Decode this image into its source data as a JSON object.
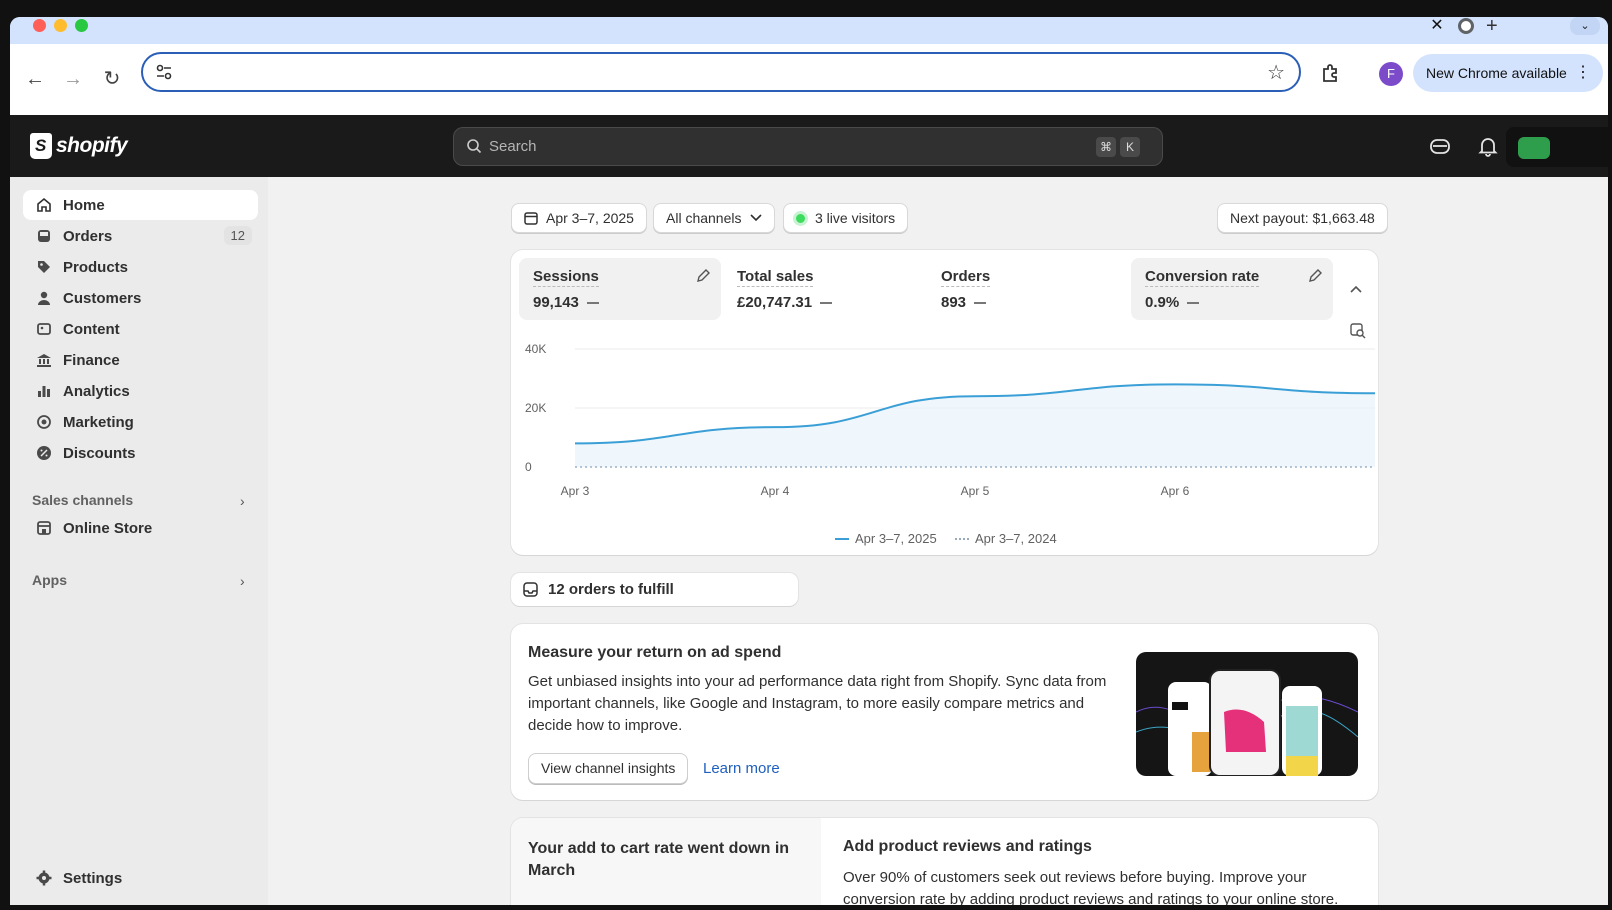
{
  "browser": {
    "new_chrome_label": "New Chrome available",
    "profile_initial": "F",
    "tab_close": "✕",
    "tab_new": "+",
    "tab_menu": "⌄"
  },
  "header": {
    "logo_text": "shopify",
    "search_placeholder": "Search",
    "shortcut_cmd": "⌘",
    "shortcut_key": "K"
  },
  "sidebar": {
    "items": [
      {
        "label": "Home",
        "icon": "home-icon"
      },
      {
        "label": "Orders",
        "icon": "inbox-icon",
        "badge": "12"
      },
      {
        "label": "Products",
        "icon": "tag-icon"
      },
      {
        "label": "Customers",
        "icon": "person-icon"
      },
      {
        "label": "Content",
        "icon": "image-icon"
      },
      {
        "label": "Finance",
        "icon": "bank-icon"
      },
      {
        "label": "Analytics",
        "icon": "bar-chart-icon"
      },
      {
        "label": "Marketing",
        "icon": "target-icon"
      },
      {
        "label": "Discounts",
        "icon": "discount-icon"
      }
    ],
    "sales_channels_heading": "Sales channels",
    "online_store_label": "Online Store",
    "apps_heading": "Apps",
    "settings_label": "Settings"
  },
  "filters": {
    "date_range": "Apr 3–7, 2025",
    "channels": "All channels",
    "live_visitors": "3 live visitors",
    "next_payout": "Next payout: $1,663.48"
  },
  "metrics": [
    {
      "label": "Sessions",
      "value": "99,143",
      "selected": true
    },
    {
      "label": "Total sales",
      "value": "£20,747.31",
      "selected": false
    },
    {
      "label": "Orders",
      "value": "893",
      "selected": false
    },
    {
      "label": "Conversion rate",
      "value": "0.9%",
      "selected": true
    }
  ],
  "chart_data": {
    "type": "line",
    "x": [
      "Apr 3",
      "Apr 4",
      "Apr 5",
      "Apr 6",
      "Apr 7"
    ],
    "x_tick_labels": [
      "Apr 3",
      "Apr 4",
      "Apr 5",
      "Apr 6"
    ],
    "y_ticks": [
      "0",
      "20K",
      "40K"
    ],
    "ylim": [
      0,
      40000
    ],
    "series": [
      {
        "name": "Apr 3–7, 2025",
        "values": [
          8000,
          13500,
          24000,
          28000,
          25000
        ],
        "color": "#3a9fd6",
        "style": "solid"
      },
      {
        "name": "Apr 3–7, 2024",
        "values": [
          0,
          0,
          0,
          0,
          0
        ],
        "color": "#9ab0c4",
        "style": "dotted"
      }
    ],
    "grid": true,
    "legend": "bottom-center"
  },
  "fulfill": {
    "label": "12 orders to fulfill"
  },
  "promo": {
    "title": "Measure your return on ad spend",
    "body": "Get unbiased insights into your ad performance data right from Shopify. Sync data from important channels, like Google and Instagram, to more easily compare metrics and decide how to improve.",
    "button": "View channel insights",
    "link": "Learn more"
  },
  "cart_tip": {
    "title": "Your add to cart rate went down in March"
  },
  "reviews": {
    "title": "Add product reviews and ratings",
    "body": "Over 90% of customers seek out reviews before buying. Improve your conversion rate by adding product reviews and ratings to your online store."
  }
}
